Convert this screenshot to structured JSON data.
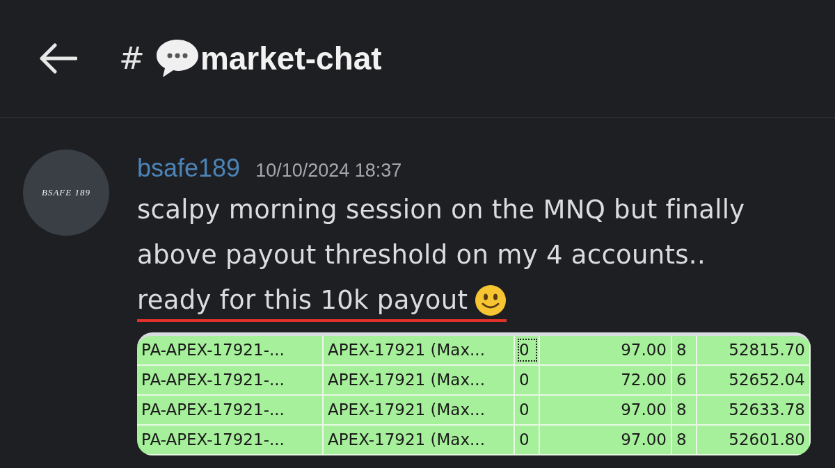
{
  "header": {
    "hash": "#",
    "channel": "market-chat"
  },
  "message": {
    "avatar_text": "BSAFE 189",
    "author": "bsafe189",
    "timestamp": "10/10/2024 18:37",
    "lines": [
      {
        "text": "scalpy morning session on the MNQ but finally",
        "underlined": false
      },
      {
        "text": "above payout threshold on my 4 accounts..",
        "underlined": false
      },
      {
        "text": "ready for this 10k payout",
        "underlined": true,
        "emoji": true
      }
    ]
  },
  "table": {
    "rows": [
      {
        "cells": [
          "PA-APEX-17921-...",
          "APEX-17921 (Max...",
          "0",
          "97.00",
          "8",
          "52815.70"
        ],
        "focused": true
      },
      {
        "cells": [
          "PA-APEX-17921-...",
          "APEX-17921 (Max...",
          "0",
          "72.00",
          "6",
          "52652.04"
        ],
        "focused": false
      },
      {
        "cells": [
          "PA-APEX-17921-...",
          "APEX-17921 (Max...",
          "0",
          "97.00",
          "8",
          "52633.78"
        ],
        "focused": false
      },
      {
        "cells": [
          "PA-APEX-17921-...",
          "APEX-17921 (Max...",
          "0",
          "97.00",
          "8",
          "52601.80"
        ],
        "focused": false
      }
    ]
  }
}
